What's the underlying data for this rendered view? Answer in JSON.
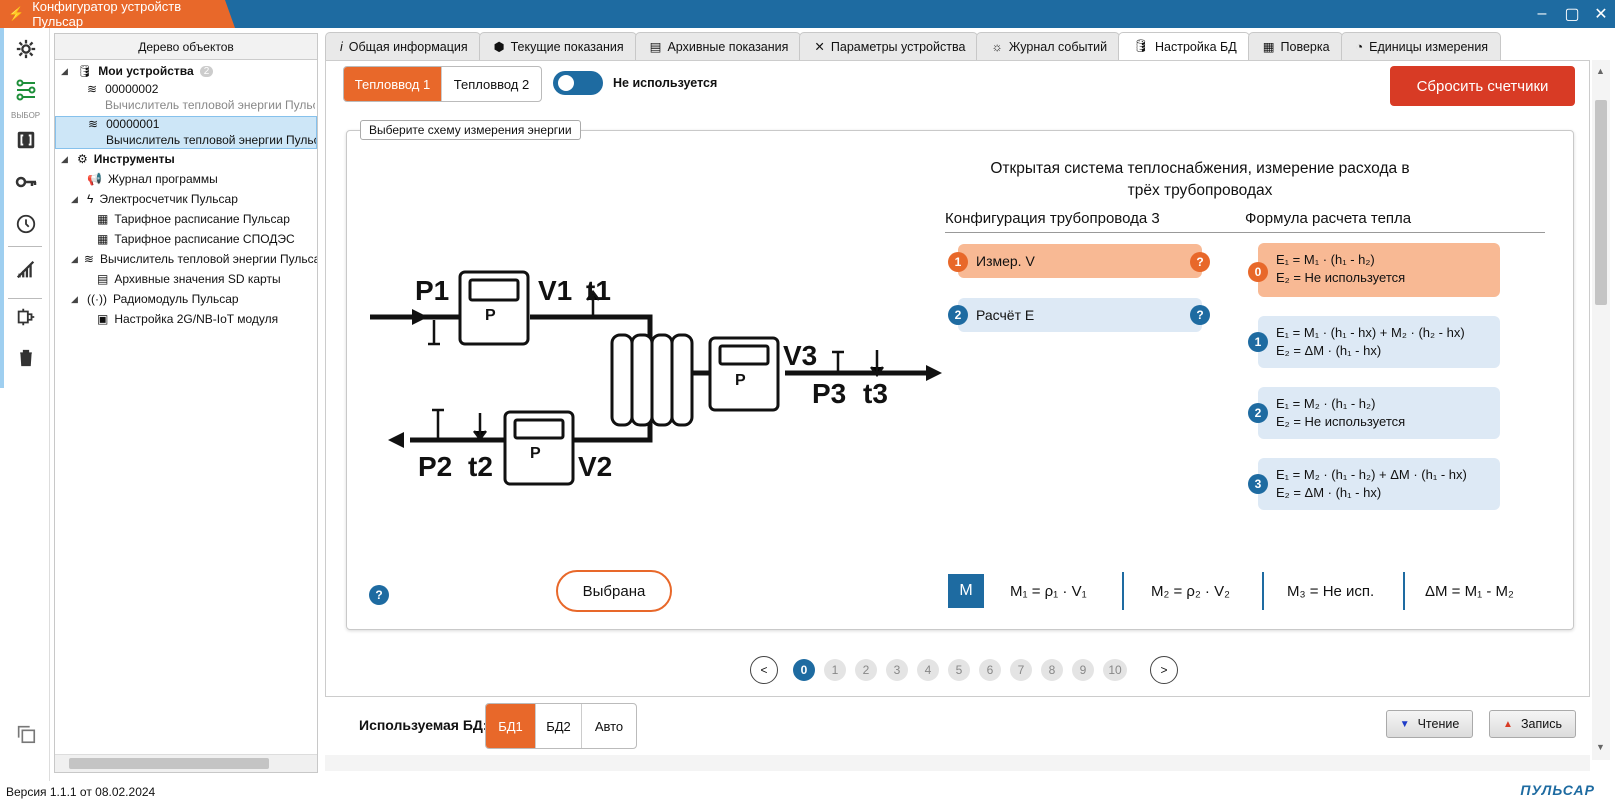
{
  "window": {
    "title": "Конфигуратор устройств Пульсар"
  },
  "sidebar": {
    "vybor_label": "ВЫБОР"
  },
  "tree": {
    "header": "Дерево объектов",
    "my_devices": "Мои устройства",
    "my_devices_count": "2",
    "dev1_id": "00000002",
    "dev1_name": "Вычислитель тепловой энергии Пульсар",
    "dev2_id": "00000001",
    "dev2_name": "Вычислитель тепловой энергии Пульсар",
    "tools": "Инструменты",
    "journal": "Журнал программы",
    "elmeter": "Электросчетчик Пульсар",
    "tariff1": "Тарифное расписание Пульсар",
    "tariff2": "Тарифное расписание СПОДЭС",
    "heatcalc": "Вычислитель тепловой энергии Пульсар",
    "archive_sd": "Архивные значения SD карты",
    "radio": "Радиомодуль Пульсар",
    "iot": "Настройка 2G/NB-IoT модуля"
  },
  "tabs": [
    "Общая информация",
    "Текущие показания",
    "Архивные показания",
    "Параметры устройства",
    "Журнал событий",
    "Настройка БД",
    "Поверка",
    "Единицы измерения"
  ],
  "inputs": {
    "tv1": "Тепловвод 1",
    "tv2": "Тепловвод 2",
    "toggle_label": "Не используется",
    "reset": "Сбросить счетчики"
  },
  "scheme": {
    "legend": "Выберите схему измерения энергии",
    "title": "Открытая система теплоснабжения, измерение расхода в трёх трубопроводах",
    "pipe_head": "Конфигурация трубопровода 3",
    "formula_head": "Формула расчета тепла",
    "pipe_items": [
      "Измер. V",
      "Расчёт E"
    ],
    "formulas": [
      {
        "n": "0",
        "e1": "E₁ = M₁ · (h₁ - h₂)",
        "e2": "E₂ = Не используется"
      },
      {
        "n": "1",
        "e1": "E₁ = M₁ · (h₁ - hx) + M₂ · (h₂ - hx)",
        "e2": "E₂ = ΔM · (h₁ - hx)"
      },
      {
        "n": "2",
        "e1": "E₁ = M₂ · (h₁ - h₂)",
        "e2": "E₂ = Не используется"
      },
      {
        "n": "3",
        "e1": "E₁ = M₂ · (h₁ - h₂) + ΔM · (h₁ - hx)",
        "e2": "E₂ = ΔM · (h₁ - hx)"
      }
    ],
    "chosen": "Выбрана",
    "m_badge": "M",
    "m1": "M₁ = ρ₁ · V₁",
    "m2": "M₂ = ρ₂ · V₂",
    "m3": "M₃ = Не исп.",
    "dm": "ΔM = M₁ - M₂",
    "diagram": {
      "p1": "P1",
      "v1": "V1",
      "t1": "t1",
      "v3": "V3",
      "p3": "P3",
      "t3": "t3",
      "p2": "P2",
      "t2": "t2",
      "v2": "V2",
      "meter": "P"
    }
  },
  "pagination": {
    "pages": [
      "0",
      "1",
      "2",
      "3",
      "4",
      "5",
      "6",
      "7",
      "8",
      "9",
      "10"
    ],
    "current": "0",
    "prev": "<",
    "next": ">"
  },
  "bottom": {
    "db_label": "Используемая БД:",
    "db1": "БД1",
    "db2": "БД2",
    "auto": "Авто",
    "read": "Чтение",
    "write": "Запись"
  },
  "status": {
    "version": "Версия 1.1.1 от 08.02.2024",
    "logo": "ПУЛЬСАР"
  }
}
